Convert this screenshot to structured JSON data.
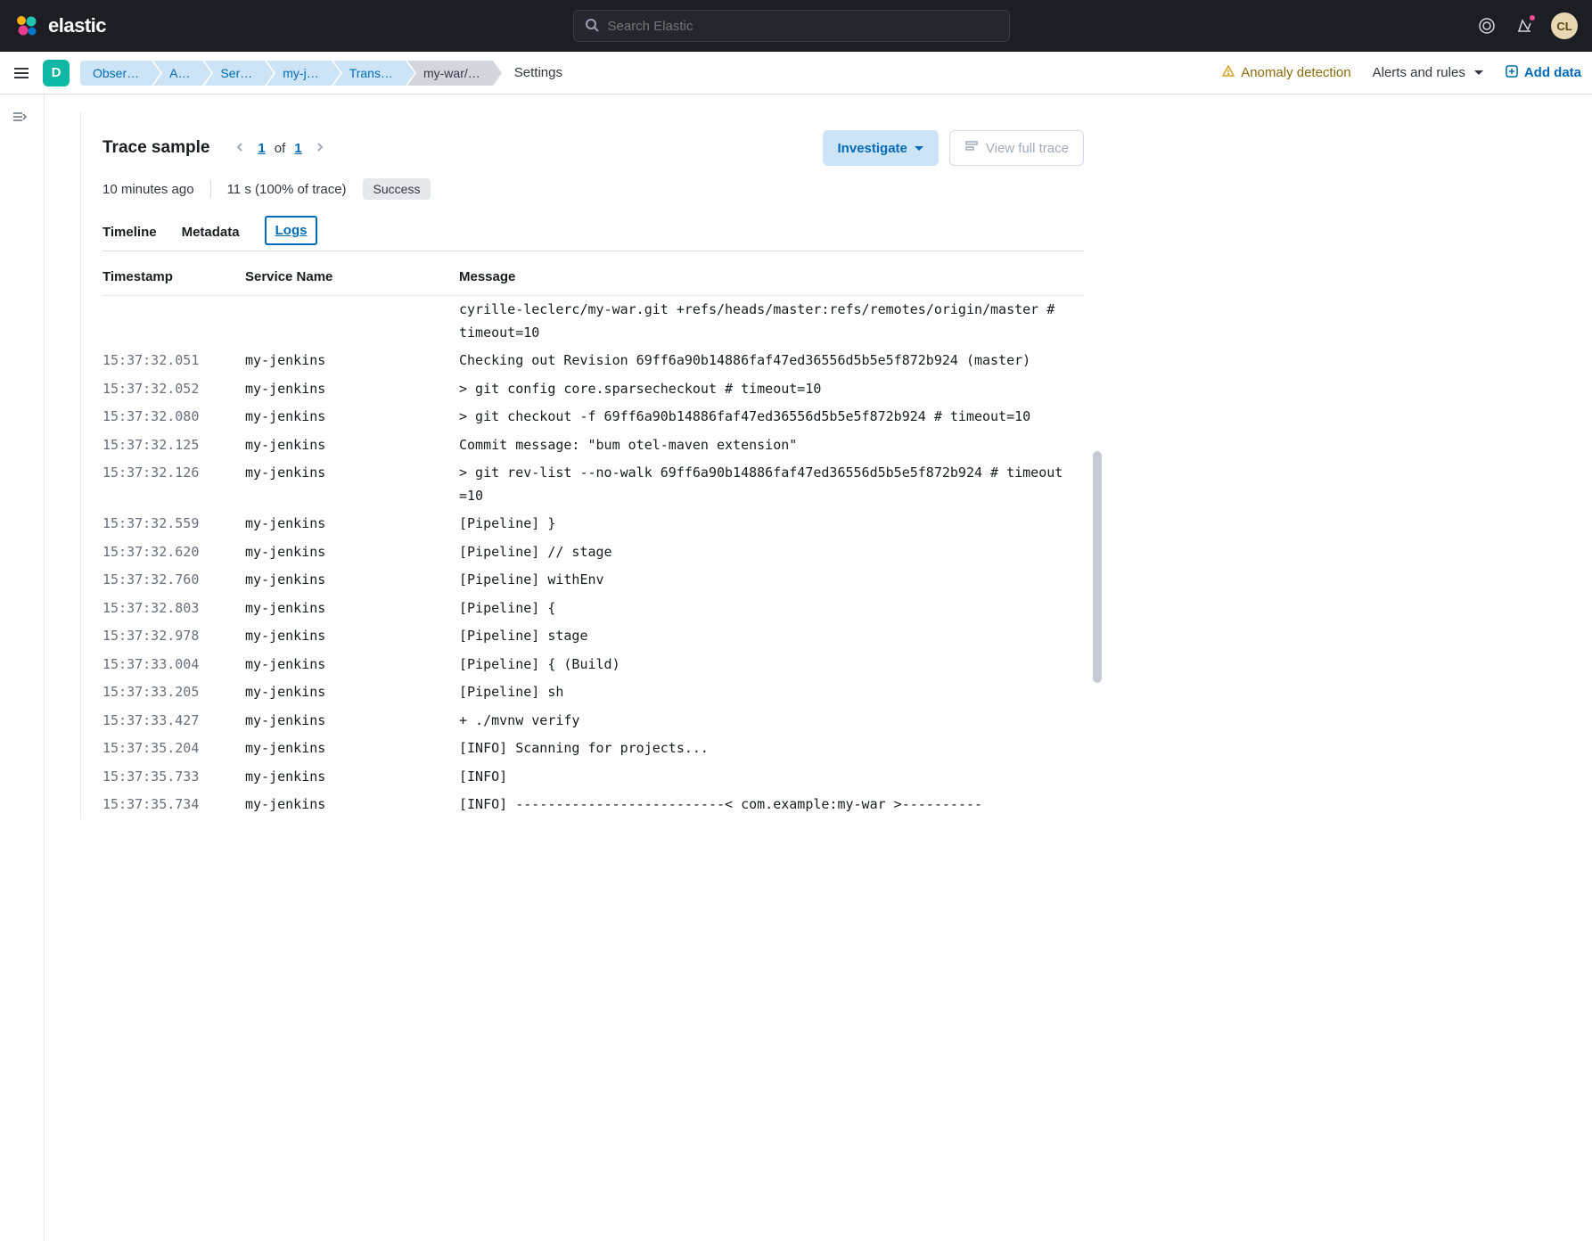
{
  "header": {
    "brand": "elastic",
    "search_placeholder": "Search Elastic",
    "avatar_initials": "CL"
  },
  "secbar": {
    "space_letter": "D",
    "breadcrumbs": [
      {
        "label": "Obser…"
      },
      {
        "label": "A…"
      },
      {
        "label": "Ser…"
      },
      {
        "label": "my-j…"
      },
      {
        "label": "Trans…"
      },
      {
        "label": "my-war/…",
        "active": true
      }
    ],
    "settings": "Settings",
    "anomaly": "Anomaly detection",
    "alerts": "Alerts and rules",
    "add_data": "Add data"
  },
  "trace": {
    "title": "Trace sample",
    "page_current": "1",
    "page_of": "of",
    "page_total": "1",
    "time_ago": "10 minutes ago",
    "duration": "11 s (100% of trace)",
    "status": "Success",
    "investigate": "Investigate",
    "view_full": "View full trace",
    "tabs": {
      "timeline": "Timeline",
      "metadata": "Metadata",
      "logs": "Logs"
    }
  },
  "table": {
    "headers": {
      "timestamp": "Timestamp",
      "service": "Service Name",
      "message": "Message"
    },
    "rows": [
      {
        "ts": "",
        "svc": "",
        "msg": "cyrille-leclerc/my-war.git +refs/heads/master:refs/remotes/origin/master # timeout=10",
        "continuation": true
      },
      {
        "ts": "15:37:32.051",
        "svc": "my-jenkins",
        "msg": "Checking out Revision 69ff6a90b14886faf47ed36556d5b5e5f872b924 (master)"
      },
      {
        "ts": "15:37:32.052",
        "svc": "my-jenkins",
        "msg": " > git config core.sparsecheckout # timeout=10"
      },
      {
        "ts": "15:37:32.080",
        "svc": "my-jenkins",
        "msg": " > git checkout -f 69ff6a90b14886faf47ed36556d5b5e5f872b924 # timeout=10"
      },
      {
        "ts": "15:37:32.125",
        "svc": "my-jenkins",
        "msg": "Commit message: \"bum otel-maven extension\""
      },
      {
        "ts": "15:37:32.126",
        "svc": "my-jenkins",
        "msg": " > git rev-list --no-walk 69ff6a90b14886faf47ed36556d5b5e5f872b924 # timeout=10"
      },
      {
        "ts": "15:37:32.559",
        "svc": "my-jenkins",
        "msg": "[Pipeline] }"
      },
      {
        "ts": "15:37:32.620",
        "svc": "my-jenkins",
        "msg": "[Pipeline] // stage"
      },
      {
        "ts": "15:37:32.760",
        "svc": "my-jenkins",
        "msg": "[Pipeline] withEnv"
      },
      {
        "ts": "15:37:32.803",
        "svc": "my-jenkins",
        "msg": "[Pipeline] {"
      },
      {
        "ts": "15:37:32.978",
        "svc": "my-jenkins",
        "msg": "[Pipeline] stage"
      },
      {
        "ts": "15:37:33.004",
        "svc": "my-jenkins",
        "msg": "[Pipeline] { (Build)"
      },
      {
        "ts": "15:37:33.205",
        "svc": "my-jenkins",
        "msg": "[Pipeline] sh"
      },
      {
        "ts": "15:37:33.427",
        "svc": "my-jenkins",
        "msg": "+ ./mvnw verify"
      },
      {
        "ts": "15:37:35.204",
        "svc": "my-jenkins",
        "msg": "[INFO] Scanning for projects..."
      },
      {
        "ts": "15:37:35.733",
        "svc": "my-jenkins",
        "msg": "[INFO]"
      },
      {
        "ts": "15:37:35.734",
        "svc": "my-jenkins",
        "msg": "[INFO] --------------------------< com.example:my-war >----------"
      }
    ]
  }
}
